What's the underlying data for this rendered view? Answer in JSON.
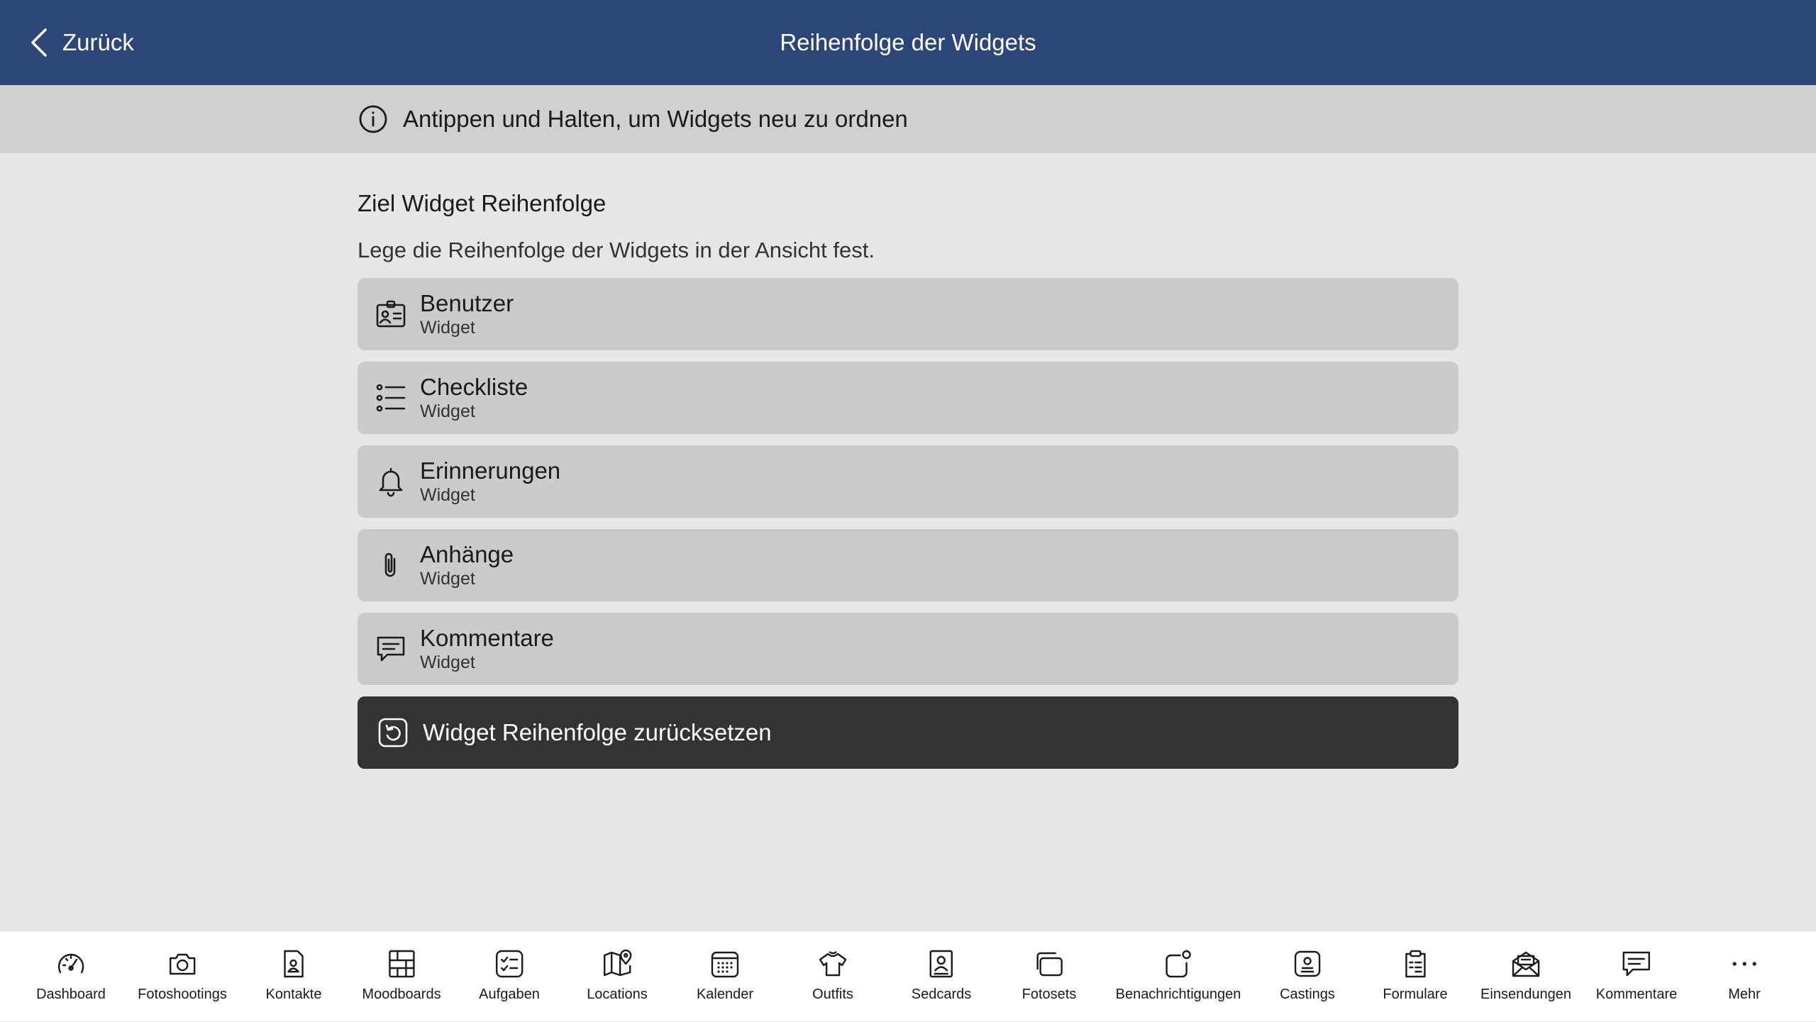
{
  "header": {
    "back_label": "Zurück",
    "title": "Reihenfolge der Widgets"
  },
  "info": {
    "icon": "info-icon",
    "text": "Antippen und Halten, um Widgets neu zu ordnen"
  },
  "section": {
    "title": "Ziel Widget Reihenfolge",
    "description": "Lege die Reihenfolge der Widgets in der Ansicht fest."
  },
  "widgets": [
    {
      "icon": "user-card-icon",
      "name": "Benutzer",
      "subtitle": "Widget"
    },
    {
      "icon": "checklist-icon",
      "name": "Checkliste",
      "subtitle": "Widget"
    },
    {
      "icon": "bell-icon",
      "name": "Erinnerungen",
      "subtitle": "Widget"
    },
    {
      "icon": "paperclip-icon",
      "name": "Anhänge",
      "subtitle": "Widget"
    },
    {
      "icon": "comment-icon",
      "name": "Kommentare",
      "subtitle": "Widget"
    }
  ],
  "reset": {
    "icon": "reset-icon",
    "label": "Widget Reihenfolge zurücksetzen"
  },
  "tabs": [
    {
      "label": "Dashboard",
      "icon": "speedometer-icon"
    },
    {
      "label": "Fotoshootings",
      "icon": "camera-icon"
    },
    {
      "label": "Kontakte",
      "icon": "contact-file-icon"
    },
    {
      "label": "Moodboards",
      "icon": "moodboard-icon"
    },
    {
      "label": "Aufgaben",
      "icon": "task-checklist-icon"
    },
    {
      "label": "Locations",
      "icon": "map-pin-icon"
    },
    {
      "label": "Kalender",
      "icon": "calendar-icon"
    },
    {
      "label": "Outfits",
      "icon": "shirt-icon"
    },
    {
      "label": "Sedcards",
      "icon": "sedcard-icon"
    },
    {
      "label": "Fotosets",
      "icon": "photo-stack-icon"
    },
    {
      "label": "Benachrichtigungen",
      "icon": "notification-icon"
    },
    {
      "label": "Castings",
      "icon": "casting-icon"
    },
    {
      "label": "Formulare",
      "icon": "clipboard-form-icon"
    },
    {
      "label": "Einsendungen",
      "icon": "envelope-open-icon"
    },
    {
      "label": "Kommentare",
      "icon": "comment-icon"
    },
    {
      "label": "Mehr",
      "icon": "more-dots-icon"
    }
  ],
  "colors": {
    "header_bg": "#2c4677",
    "info_bg": "#d0d0d0",
    "page_bg": "#e6e6e6",
    "item_bg": "#cbcbcb",
    "reset_bg": "#333333"
  }
}
